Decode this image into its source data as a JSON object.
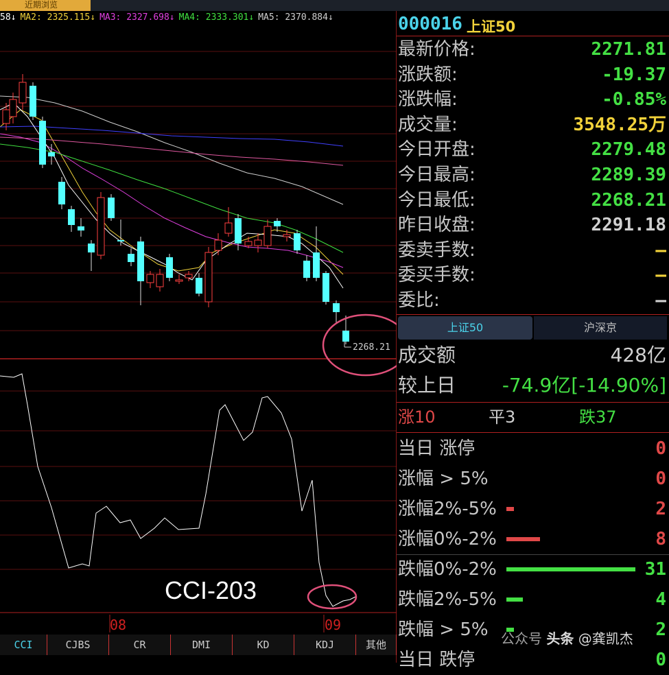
{
  "top_tab": "近期浏览",
  "ma_row": [
    {
      "label": "58↓",
      "color": "#ffffff"
    },
    {
      "label": "MA2: 2325.115↓",
      "color": "#f0d23a"
    },
    {
      "label": "MA3: 2327.698↓",
      "color": "#e040e0"
    },
    {
      "label": "MA4: 2333.301↓",
      "color": "#40e040"
    },
    {
      "label": "MA5: 2370.884↓",
      "color": "#d0d0d0"
    }
  ],
  "price_marker": "2268.21",
  "annotation": "CCI-203",
  "axis_dates": [
    "08",
    "09"
  ],
  "indicator_tabs": [
    "CCI",
    "CJBS",
    "CR",
    "DMI",
    "KD",
    "KDJ",
    "其他"
  ],
  "quote": {
    "code": "000016",
    "name": "上证50",
    "rows": [
      {
        "label": "最新价格:",
        "value": "2271.81",
        "color": "#44e044"
      },
      {
        "label": "涨跌额:",
        "value": "-19.37",
        "color": "#44e044"
      },
      {
        "label": "涨跌幅:",
        "value": "-0.85%",
        "color": "#44e044"
      },
      {
        "label": "成交量:",
        "value": "3548.25万",
        "color": "#f2d23a"
      },
      {
        "label": "今日开盘:",
        "value": "2279.48",
        "color": "#44e044"
      },
      {
        "label": "今日最高:",
        "value": "2289.39",
        "color": "#44e044"
      },
      {
        "label": "今日最低:",
        "value": "2268.21",
        "color": "#44e044"
      },
      {
        "label": "昨日收盘:",
        "value": "2291.18",
        "color": "#d0d0d0"
      },
      {
        "label": "委卖手数:",
        "value": "—",
        "color": "#f2d23a"
      },
      {
        "label": "委买手数:",
        "value": "—",
        "color": "#f2d23a"
      },
      {
        "label": "委比:",
        "value": "—",
        "color": "#d0d0d0"
      }
    ]
  },
  "market_tabs": [
    "上证50",
    "沪深京"
  ],
  "turnover": {
    "label": "成交额",
    "value": "428亿"
  },
  "vs_prev": {
    "label": "较上日",
    "value": "-74.9亿[-14.90%]"
  },
  "breadth": {
    "up_label": "涨10",
    "flat_label": "平3",
    "down_label": "跌37"
  },
  "distribution": [
    {
      "label": "当日 涨停",
      "value": "0",
      "color": "#e04848",
      "fill": 0
    },
    {
      "label": "涨幅 > 5%",
      "value": "0",
      "color": "#e04848",
      "fill": 0
    },
    {
      "label": "涨幅2%-5%",
      "value": "2",
      "color": "#e04848",
      "fill": 0.06
    },
    {
      "label": "涨幅0%-2%",
      "value": "8",
      "color": "#e04848",
      "fill": 0.26
    },
    {
      "label": "跌幅0%-2%",
      "value": "31",
      "color": "#44e044",
      "fill": 1.0
    },
    {
      "label": "跌幅2%-5%",
      "value": "4",
      "color": "#44e044",
      "fill": 0.13
    },
    {
      "label": "跌幅 > 5%",
      "value": "2",
      "color": "#44e044",
      "fill": 0.06
    },
    {
      "label": "当日 跌停",
      "value": "0",
      "color": "#44e044",
      "fill": 0
    }
  ],
  "watermark": {
    "prefix": "公众号",
    "brand": "头条",
    "author": "@龚凯杰"
  }
}
